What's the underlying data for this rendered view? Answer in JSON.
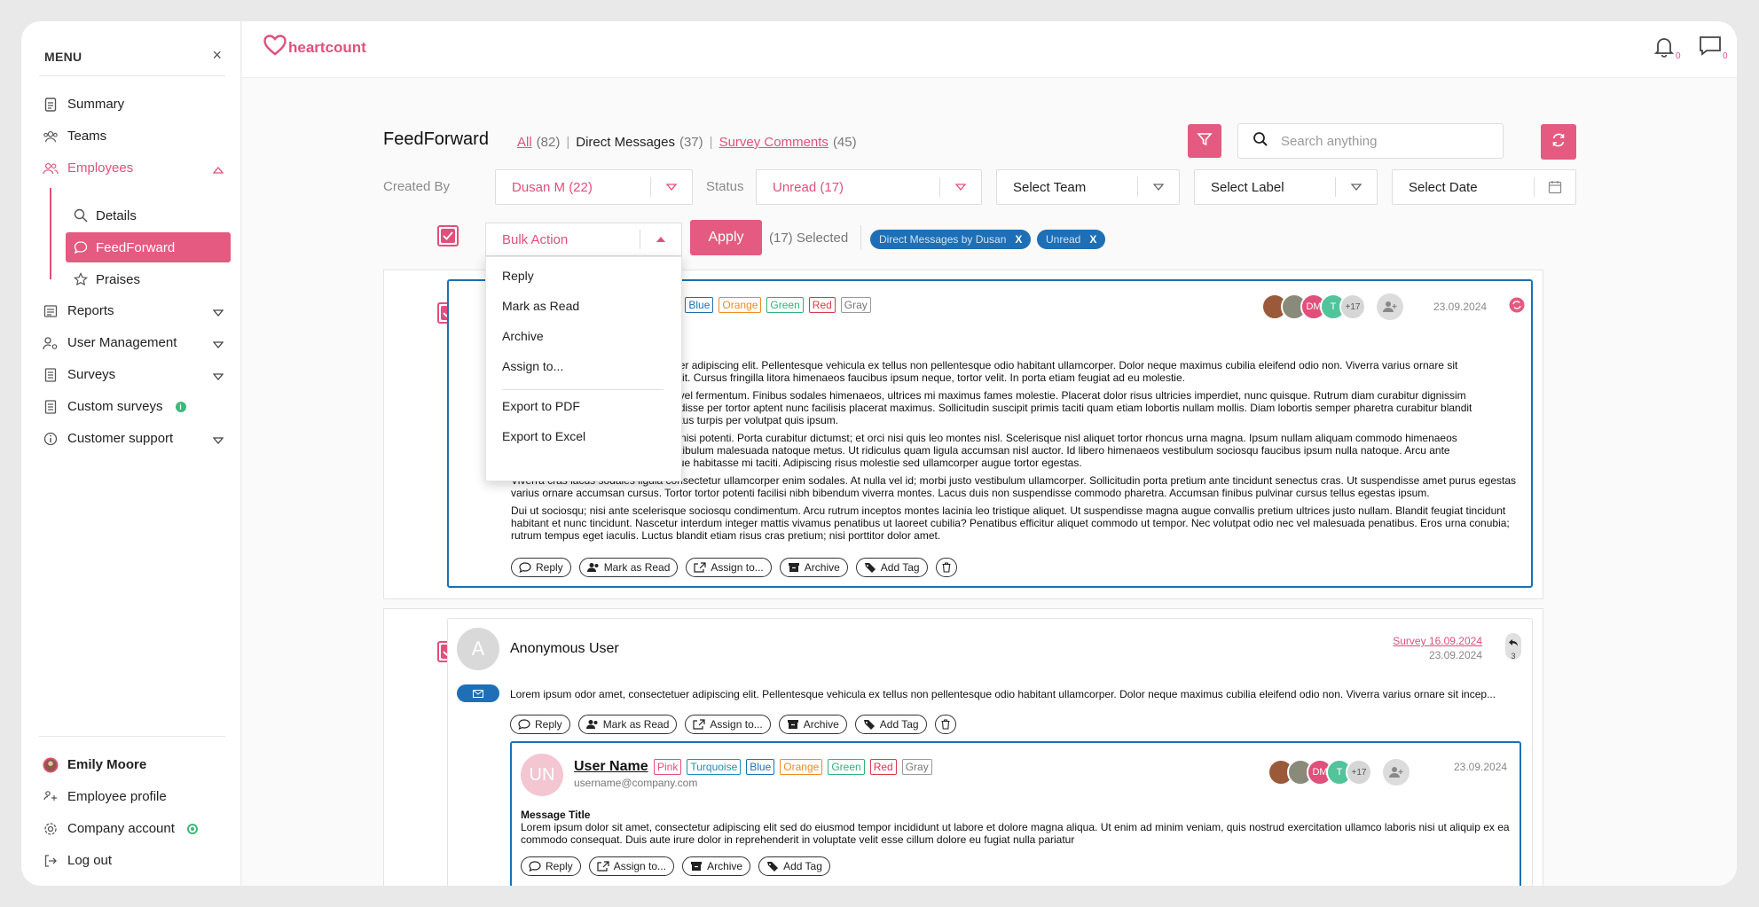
{
  "sidebar": {
    "title": "MENU",
    "close": "×",
    "items": {
      "summary": "Summary",
      "teams": "Teams",
      "employees": "Employees",
      "details": "Details",
      "feedforward": "FeedForward",
      "praises": "Praises",
      "reports": "Reports",
      "user_management": "User Management",
      "surveys": "Surveys",
      "custom_surveys": "Custom surveys",
      "customer_support": "Customer support"
    },
    "user": {
      "name": "Emily Moore",
      "employee_profile": "Employee profile",
      "company_account": "Company account",
      "logout": "Log out"
    }
  },
  "topbar": {
    "logo": "heartcount",
    "notif_count": "0",
    "msg_count": "0"
  },
  "page": {
    "title": "FeedForward",
    "tabs": {
      "all": "All",
      "all_count": "(82)",
      "dm": "Direct Messages",
      "dm_count": "(37)",
      "survey": "Survey Comments",
      "survey_count": "(45)"
    },
    "search_placeholder": "Search anything"
  },
  "filters": {
    "created_by_label": "Created By",
    "created_by_value": "Dusan M (22)",
    "status_label": "Status",
    "status_value": "Unread (17)",
    "team": "Select Team",
    "label": "Select Label",
    "date": "Select Date"
  },
  "bulk": {
    "value": "Bulk Action",
    "options": {
      "reply": "Reply",
      "mark_read": "Mark as Read",
      "archive": "Archive",
      "assign": "Assign to...",
      "export_pdf": "Export to PDF",
      "export_excel": "Export to Excel"
    },
    "apply": "Apply",
    "selected": "(17) Selected",
    "chip1": "Direct Messages by Dusan",
    "chip2": "Unread",
    "chip_x": "X"
  },
  "tags": {
    "pink": "Pink",
    "turquoise": "Turquoise",
    "turquoise_partial": "rquoise",
    "blue": "Blue",
    "orange": "Orange",
    "green": "Green",
    "red": "Red",
    "gray": "Gray"
  },
  "avatars": {
    "dm": "DM",
    "t": "T",
    "more": "+17"
  },
  "actions": {
    "reply": "Reply",
    "mark_read": "Mark as Read",
    "assign": "Assign to...",
    "archive": "Archive",
    "add_tag": "Add Tag"
  },
  "card1": {
    "date": "23.09.2024",
    "p1a": "sectetuer adipiscing elit. Pellentesque vehicula ex tellus non pellentesque odio habitant ullamcorper. Dolor neque maximus cubilia eleifend odio non. Viverra varius ornare sit",
    "p1b": "eget velit. Cursus fringilla litora himenaeos faucibus ipsum neque, tortor velit. In porta etiam feugiat ad eu molestie.",
    "p2a": "ctor sit vel fermentum. Finibus sodales himenaeos, ultrices mi maximus fames molestie. Placerat dolor risus ultricies imperdiet, nunc quisque. Rutrum diam curabitur dignissim",
    "p2b": "suspendisse per tortor aptent nunc facilisis placerat maximus. Sollicitudin suscipit primis taciti quam etiam lobortis nullam mollis. Diam lobortis semper pharetra curabitur blandit",
    "p2c": "iam metus turpis per volutpat quis ipsum.",
    "p3a": "elis elit nisi potenti. Porta curabitur dictumst; et orci nisi quis leo montes nisl. Scelerisque nisl aliquet tortor rhoncus urna magna. Ipsum nullam aliquam commodo himenaeos",
    "p3b": "mattis eget. Tincidunt sit feugiat vestibulum malesuada natoque metus. Ut ridiculus quam ligula accumsan nisl auctor. Id libero himenaeos vestibulum sociosqu faucibus ipsum nulla natoque. Arcu ante",
    "p3c": "aliquam orci dapibus natoque quisque habitasse mi taciti. Adipiscing risus molestie sed ullamcorper augue tortor egestas.",
    "p4": "Viverra cras lacus sodales ligula consectetur ullamcorper enim sodales. At nulla vel id; morbi justo vestibulum ullamcorper. Sollicitudin porta pretium ante tincidunt senectus cras. Ut suspendisse amet purus egestas varius ornare accumsan cursus. Tortor tortor potenti facilisi nibh bibendum viverra montes. Lacus duis non suspendisse commodo pharetra. Accumsan finibus pulvinar cursus tellus egestas ipsum.",
    "p5": "Dui ut sociosqu; nisi ante scelerisque sociosqu condimentum. Arcu rutrum inceptos montes lacinia leo tristique aliquet. Ut suspendisse magna augue convallis pretium ultrices justo nullam. Blandit feugiat tincidunt habitant et nunc tincidunt. Nascetur interdum integer mattis vivamus penatibus ut laoreet cubilia? Penatibus efficitur aliquet commodo ut tempor. Nec volutpat odio nec vel malesuada penatibus. Eros urna conubia; rutrum tempus eget iaculis. Luctus blandit etiam risus cras pretium; nisi porttitor dolor amet."
  },
  "card2": {
    "avatar": "A",
    "user": "Anonymous User",
    "survey": "Survey 16.09.2024",
    "date": "23.09.2024",
    "reply_count": "3",
    "text": "Lorem ipsum odor amet, consectetuer adipiscing elit. Pellentesque vehicula ex tellus non pellentesque odio habitant ullamcorper. Dolor neque maximus cubilia eleifend odio non. Viverra varius ornare sit incep...",
    "nested": {
      "avatar": "UN",
      "user": "User Name",
      "email": "username@company.com",
      "date": "23.09.2024",
      "title": "Message Title",
      "text": "Lorem ipsum dolor sit amet, consectetur adipiscing elit sed do eiusmod tempor incididunt ut labore et dolore magna aliqua. Ut enim ad minim veniam, quis nostrud exercitation ullamco laboris nisi ut aliquip ex ea commodo consequat. Duis aute irure dolor in reprehenderit in voluptate velit esse cillum dolore eu fugiat nulla pariatur"
    }
  },
  "colors": {
    "accent": "#e45a80",
    "blue": "#1e6fb5"
  }
}
